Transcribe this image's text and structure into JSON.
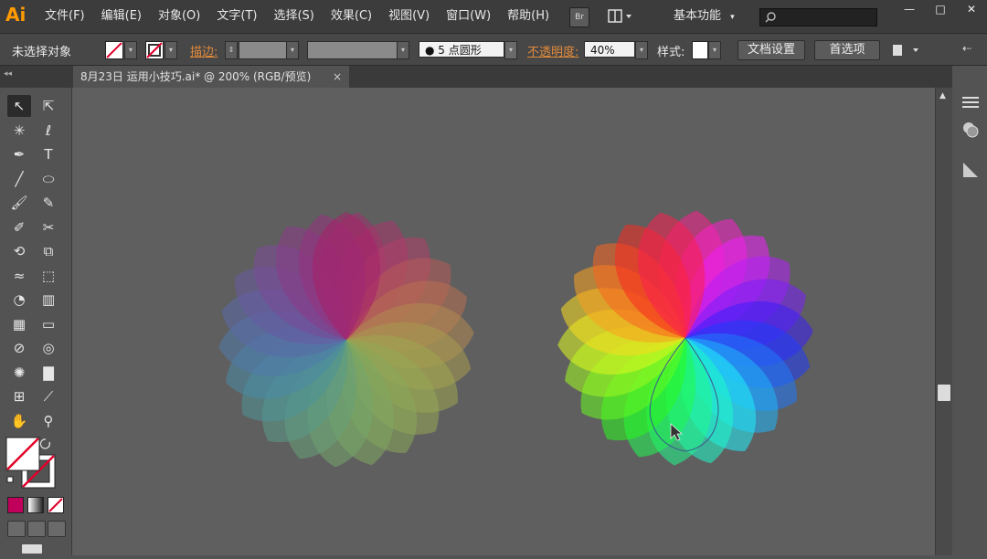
{
  "app": {
    "logo": "Ai"
  },
  "menubar": {
    "items": [
      "文件(F)",
      "编辑(E)",
      "对象(O)",
      "文字(T)",
      "选择(S)",
      "效果(C)",
      "视图(V)",
      "窗口(W)",
      "帮助(H)"
    ],
    "bridge_label": "Br",
    "workspace": "基本功能",
    "window_controls": [
      "—",
      "□",
      "✕"
    ]
  },
  "control_bar": {
    "selection_status": "未选择对象",
    "stroke_label": "描边:",
    "brush_value": "●  5 点圆形",
    "opacity_label": "不透明度:",
    "opacity_value": "40%",
    "style_label": "样式:",
    "document_setup": "文档设置",
    "preferences": "首选项"
  },
  "document": {
    "tab_title": "8月23日  运用小技巧.ai* @ 200% (RGB/预览)",
    "close": "×"
  },
  "colors": {
    "menubar_bg": "#3c3c3c",
    "controlbar_bg": "#474747",
    "canvas_bg": "#5f5f5f",
    "accent_orange": "#ff9a00",
    "fill_swatch": "#c0005a"
  },
  "tools": [
    "selection-tool",
    "direct-selection-tool",
    "magic-wand-tool",
    "lasso-tool",
    "pen-tool",
    "type-tool",
    "line-segment-tool",
    "ellipse-tool",
    "paintbrush-tool",
    "pencil-tool",
    "blob-brush-tool",
    "scissors-tool",
    "rotate-tool",
    "scale-tool",
    "warp-tool",
    "free-transform-tool",
    "shape-builder-tool",
    "graph-tool",
    "mesh-tool",
    "gradient-tool",
    "eyedropper-tool",
    "blend-tool",
    "symbol-sprayer-tool",
    "column-graph-tool",
    "artboard-tool",
    "slice-tool",
    "hand-tool",
    "zoom-tool"
  ],
  "tool_glyphs": {
    "type-tool": "T"
  }
}
